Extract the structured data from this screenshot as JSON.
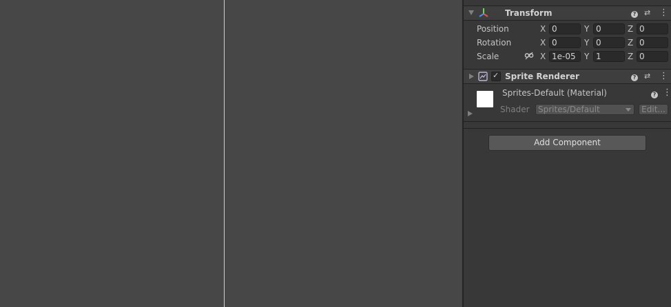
{
  "transform": {
    "title": "Transform",
    "rows": [
      {
        "label": "Position",
        "x": "0",
        "y": "0",
        "z": "0"
      },
      {
        "label": "Rotation",
        "x": "0",
        "y": "0",
        "z": "0"
      },
      {
        "label": "Scale",
        "x": "1e-05",
        "y": "1",
        "z": "0"
      }
    ],
    "axis_x": "X",
    "axis_y": "Y",
    "axis_z": "Z"
  },
  "sprite_renderer": {
    "title": "Sprite Renderer",
    "material_name": "Sprites-Default (Material)",
    "shader_label": "Shader",
    "shader_value": "Sprites/Default",
    "edit_label": "Edit..."
  },
  "add_component_label": "Add Component",
  "icons": {
    "help": "?",
    "presets": "⇄",
    "more": "⋮",
    "check": "✓"
  },
  "colors": {
    "scene_bg": "#474747",
    "inspector_bg": "#383838",
    "header_bg": "#3e3e3e",
    "swatch": "#ffffff"
  }
}
